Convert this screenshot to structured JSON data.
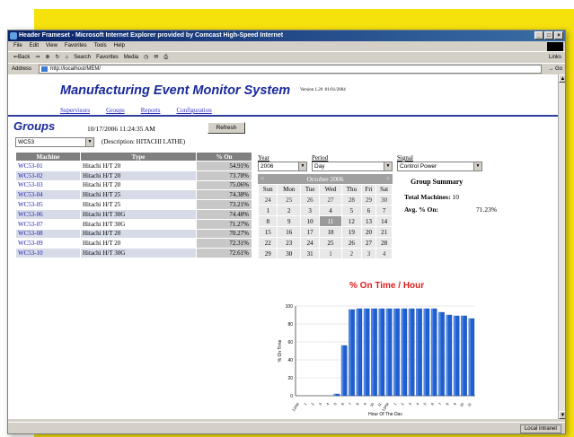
{
  "browser": {
    "title": "Header Frameset - Microsoft Internet Explorer provided by Comcast High-Speed Internet",
    "menu": [
      "File",
      "Edit",
      "View",
      "Favorites",
      "Tools",
      "Help"
    ],
    "toolbar": {
      "back": "⇐Back",
      "search": "Search",
      "favorites": "Favorites",
      "media": "Media",
      "links": "Links"
    },
    "address_label": "Address",
    "address_value": "http://localhost/MEM/",
    "go_label": "Go",
    "status_zone": "Local intranet"
  },
  "app": {
    "title": "Manufacturing Event Monitor System",
    "version": "Version 1.20 :01/01/2004",
    "nav": [
      "Supervisors",
      "Groups",
      "Reports",
      "Configuration"
    ]
  },
  "groups": {
    "heading": "Groups",
    "datetime": "10/17/2006 11:24:35 AM",
    "refresh_label": "Refresh",
    "selected_group": "WC53",
    "description": "(Description: HITACHI LATHE)",
    "table": {
      "headers": [
        "Machine",
        "Type",
        "% On"
      ],
      "rows": [
        {
          "machine": "WC53-01",
          "type": "Hitachi H/T 20",
          "pct": "54.91%"
        },
        {
          "machine": "WC53-02",
          "type": "Hitachi H/T 20",
          "pct": "73.78%"
        },
        {
          "machine": "WC53-03",
          "type": "Hitachi H/T 20",
          "pct": "75.06%"
        },
        {
          "machine": "WC53-04",
          "type": "Hitachi H/T 25",
          "pct": "74.38%"
        },
        {
          "machine": "WC53-05",
          "type": "Hitachi H/T 25",
          "pct": "73.21%"
        },
        {
          "machine": "WC53-06",
          "type": "Hitachi H/T 30G",
          "pct": "74.48%"
        },
        {
          "machine": "WC53-07",
          "type": "Hitachi H/T 30G",
          "pct": "71.27%"
        },
        {
          "machine": "WC53-08",
          "type": "Hitachi H/T 20",
          "pct": "70.27%"
        },
        {
          "machine": "WC53-09",
          "type": "Hitachi H/T 20",
          "pct": "72.31%"
        },
        {
          "machine": "WC53-10",
          "type": "Hitachi H/T 30G",
          "pct": "72.61%"
        }
      ]
    }
  },
  "filters": {
    "year_label": "Year",
    "year_value": "2006",
    "period_label": "Period",
    "period_value": "Day",
    "signal_label": "Signal",
    "signal_value": "Control Power"
  },
  "calendar": {
    "month": "October 2006",
    "prev": "<",
    "next": ">",
    "weekdays": [
      "Sun",
      "Mon",
      "Tue",
      "Wed",
      "Thu",
      "Fri",
      "Sat"
    ],
    "weeks": [
      [
        "24",
        "25",
        "26",
        "27",
        "28",
        "29",
        "30"
      ],
      [
        "1",
        "2",
        "3",
        "4",
        "5",
        "6",
        "7"
      ],
      [
        "8",
        "9",
        "10",
        "11",
        "12",
        "13",
        "14"
      ],
      [
        "15",
        "16",
        "17",
        "18",
        "19",
        "20",
        "21"
      ],
      [
        "22",
        "23",
        "24",
        "25",
        "26",
        "27",
        "28"
      ],
      [
        "29",
        "30",
        "31",
        "1",
        "2",
        "3",
        "4"
      ]
    ],
    "selected_day": "11"
  },
  "summary": {
    "title": "Group Summary",
    "total_label": "Total Machines:",
    "total_value": "10",
    "avg_label": "Avg. % On:",
    "avg_value": "71.23%"
  },
  "chart_data": {
    "type": "bar",
    "title": "% On Time / Hour",
    "xlabel": "Hour Of The Day",
    "ylabel": "% On Time",
    "ylim": [
      0,
      100
    ],
    "yticks": [
      0,
      20,
      40,
      60,
      80,
      100
    ],
    "categories": [
      "12AM",
      "1",
      "2",
      "3",
      "4",
      "5",
      "6",
      "7",
      "8",
      "9",
      "10",
      "11",
      "12PM",
      "1",
      "2",
      "3",
      "4",
      "5",
      "6",
      "7",
      "8",
      "9",
      "10",
      "11"
    ],
    "values": [
      0,
      0,
      0,
      0,
      0,
      2,
      56,
      96,
      97,
      97,
      97,
      97,
      97,
      97,
      97,
      97,
      97,
      97,
      97,
      93,
      90,
      89,
      89,
      86
    ],
    "bar_color": "#1f5fd0",
    "grid": true
  }
}
